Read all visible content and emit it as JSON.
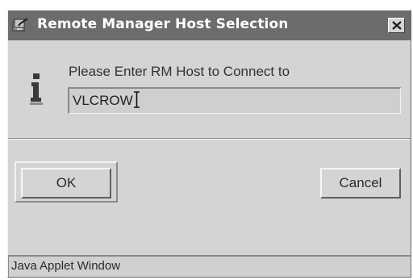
{
  "window": {
    "title": "Remote Manager Host Selection",
    "title_icon": "java-applet-icon",
    "close_icon": "close-icon"
  },
  "dialog": {
    "icon": "info-icon",
    "prompt": "Please Enter RM Host to Connect to",
    "host_input": {
      "value": "VLCROW",
      "placeholder": ""
    }
  },
  "buttons": {
    "ok_label": "OK",
    "cancel_label": "Cancel"
  },
  "status_bar": {
    "text": "Java Applet Window"
  },
  "colors": {
    "titlebar": "#6c6c6c",
    "window_bg": "#d4d4d4",
    "title_text": "#ffffff"
  }
}
